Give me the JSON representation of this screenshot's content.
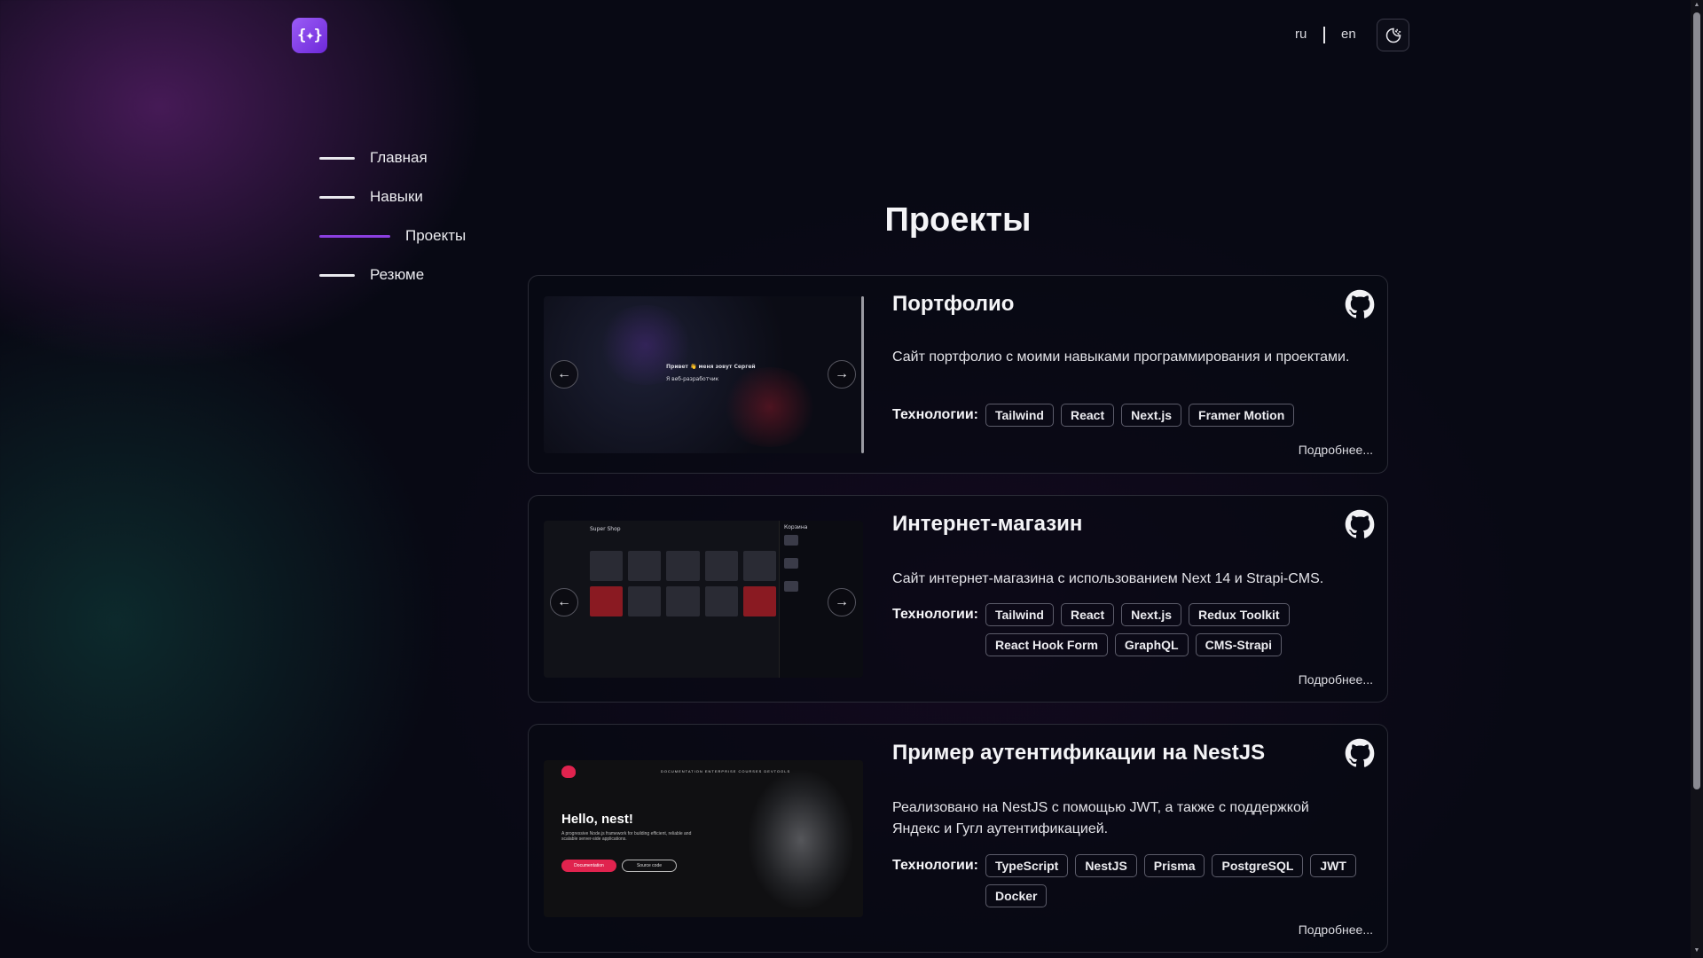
{
  "header": {
    "logo_text": "{✦}",
    "lang_ru": "ru",
    "lang_en": "en",
    "theme_icon": "theme-toggle-icon"
  },
  "nav": {
    "items": [
      {
        "label": "Главная",
        "active": false
      },
      {
        "label": "Навыки",
        "active": false
      },
      {
        "label": "Проекты",
        "active": true
      },
      {
        "label": "Резюме",
        "active": false
      }
    ]
  },
  "page": {
    "title": "Проекты"
  },
  "colors": {
    "accent": "#8b3fe0",
    "background": "#080914",
    "nest_red": "#e0234e"
  },
  "tech_label": "Технологии:",
  "more_label": "Подробнее...",
  "projects": [
    {
      "title": "Портфолио",
      "description": "Сайт портфолио с моими навыками программирования и проектами.",
      "tags": [
        "Tailwind",
        "React",
        "Next.js",
        "Framer Motion"
      ],
      "shot": {
        "line1": "Привет 👋 меня зовут Сергей",
        "line2": "Я веб-разработчик"
      }
    },
    {
      "title": "Интернет-магазин",
      "description": "Сайт интернет-магазина с использованием Next 14 и Strapi-CMS.",
      "tags": [
        "Tailwind",
        "React",
        "Next.js",
        "Redux Toolkit",
        "React Hook Form",
        "GraphQL",
        "CMS-Strapi"
      ],
      "shot": {
        "header": "Super Shop",
        "cart": "Корзина"
      }
    },
    {
      "title": "Пример аутентификации на NestJS",
      "description": "Реализовано на NestJS с помощью JWT, а также с поддержкой Яндекс и Гугл аутентификацией.",
      "tags": [
        "TypeScript",
        "NestJS",
        "Prisma",
        "PostgreSQL",
        "JWT",
        "Docker"
      ],
      "shot": {
        "hero": "Hello, nest!",
        "sub": "A progressive Node.js framework for building efficient, reliable and scalable server-side applications.",
        "btn1": "Documentation",
        "btn2": "Source code",
        "nav": "DOCUMENTATION  ENTERPRISE  COURSES  DEVTOOLS"
      }
    }
  ]
}
